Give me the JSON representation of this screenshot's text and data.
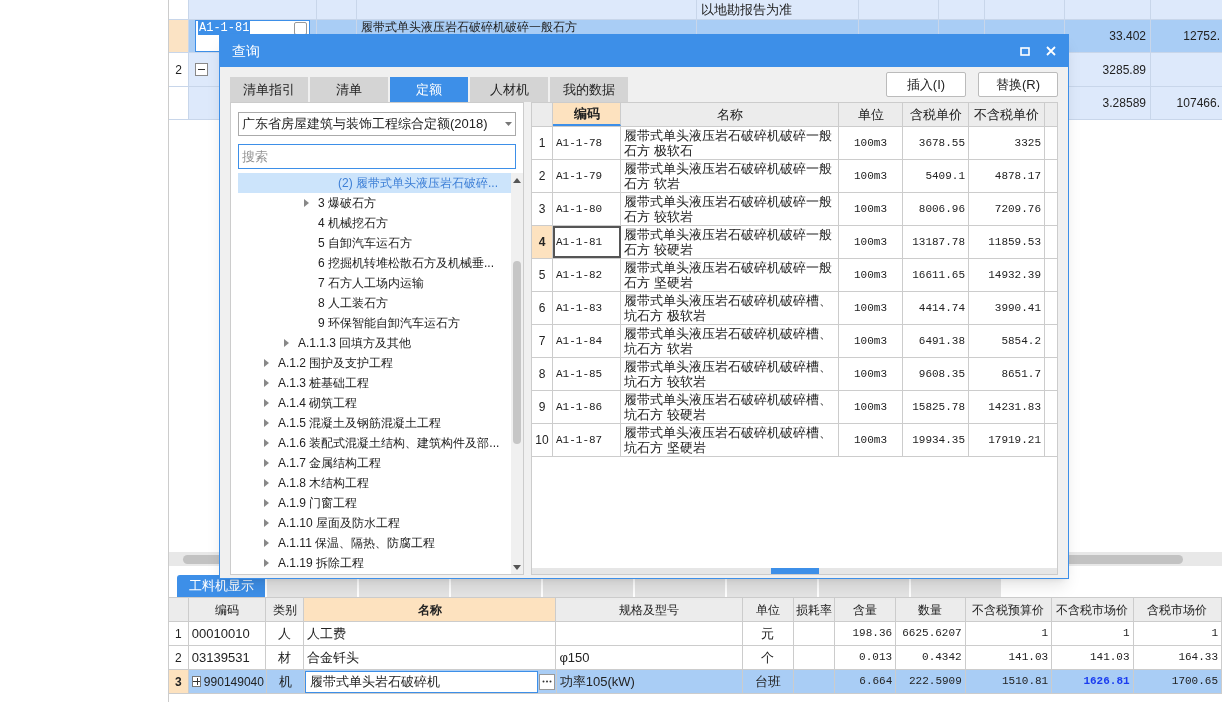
{
  "background_grid": {
    "rows": [
      {
        "kind": "partial",
        "selected": false,
        "note": "以地勘报告为准"
      },
      {
        "kind": "item",
        "code": "A1-1-81",
        "checked": false,
        "selected": true,
        "name": "履带式单头液压岩石破碎机破碎一般石方",
        "values": [
          "33.402",
          "12752."
        ]
      },
      {
        "kind": "group",
        "row_number": "2",
        "expanded": true,
        "selected": false,
        "values": [
          "3285.89"
        ]
      },
      {
        "kind": "plain",
        "selected": false,
        "values": [
          "3.28589",
          "107466."
        ]
      }
    ]
  },
  "dialog": {
    "title": "查询",
    "tabs": [
      {
        "label": "清单指引",
        "selected": false
      },
      {
        "label": "清单",
        "selected": false
      },
      {
        "label": "定额",
        "selected": true
      },
      {
        "label": "人材机",
        "selected": false
      },
      {
        "label": "我的数据",
        "selected": false
      }
    ],
    "buttons": [
      "插入(I)",
      "替换(R)"
    ],
    "library": "广东省房屋建筑与装饰工程综合定额(2018)",
    "search": {
      "placeholder": "搜索"
    },
    "tree": [
      {
        "children": [
          {
            "children": [
              {
                "children": [
                  {
                    "label": "(2) 履带式单头液压岩石破碎...",
                    "selected": true
                  }
                ]
              },
              {
                "label": "3 爆破石方",
                "expanded": false,
                "selected": false
              },
              {
                "label": "4 机械挖石方",
                "selected": false
              },
              {
                "label": "5 自卸汽车运石方",
                "selected": false
              },
              {
                "label": "6 挖掘机转堆松散石方及机械垂...",
                "selected": false
              },
              {
                "label": "7 石方人工场内运输",
                "selected": false
              },
              {
                "label": "8 人工装石方",
                "selected": false
              },
              {
                "label": "9 环保智能自卸汽车运石方",
                "selected": false
              }
            ]
          },
          {
            "label": "A.1.1.3 回填方及其他",
            "expanded": false,
            "selected": false
          }
        ]
      },
      {
        "label": "A.1.2 围护及支护工程",
        "expanded": false,
        "selected": false
      },
      {
        "label": "A.1.3 桩基础工程",
        "expanded": false,
        "selected": false
      },
      {
        "label": "A.1.4 砌筑工程",
        "expanded": false,
        "selected": false
      },
      {
        "label": "A.1.5 混凝土及钢筋混凝土工程",
        "expanded": false,
        "selected": false
      },
      {
        "label": "A.1.6 装配式混凝土结构、建筑构件及部...",
        "expanded": false,
        "selected": false
      },
      {
        "label": "A.1.7 金属结构工程",
        "expanded": false,
        "selected": false
      },
      {
        "label": "A.1.8 木结构工程",
        "expanded": false,
        "selected": false
      },
      {
        "label": "A.1.9 门窗工程",
        "expanded": false,
        "selected": false
      },
      {
        "label": "A.1.10 屋面及防水工程",
        "expanded": false,
        "selected": false
      },
      {
        "label": "A.1.11 保温、隔热、防腐工程",
        "expanded": false,
        "selected": false
      },
      {
        "label": "A.1.19 拆除工程",
        "expanded": false,
        "selected": false
      }
    ],
    "table": {
      "columns": [
        {
          "label": "编码",
          "active": true
        },
        {
          "label": "名称",
          "active": false
        },
        {
          "label": "单位",
          "active": false
        },
        {
          "label": "含税单价",
          "active": false
        },
        {
          "label": "不含税单价",
          "active": false
        }
      ],
      "rows": [
        {
          "number": "1",
          "selected": false,
          "cells": [
            "A1-1-78",
            "履带式单头液压岩石破碎机破碎一般石方 极软石",
            "100m3",
            "3678.55",
            "3325"
          ]
        },
        {
          "number": "2",
          "selected": false,
          "cells": [
            "A1-1-79",
            "履带式单头液压岩石破碎机破碎一般石方 软岩",
            "100m3",
            "5409.1",
            "4878.17"
          ]
        },
        {
          "number": "3",
          "selected": false,
          "cells": [
            "A1-1-80",
            "履带式单头液压岩石破碎机破碎一般石方 较软岩",
            "100m3",
            "8006.96",
            "7209.76"
          ]
        },
        {
          "number": "4",
          "selected": true,
          "cells": [
            "A1-1-81",
            "履带式单头液压岩石破碎机破碎一般石方 较硬岩",
            "100m3",
            "13187.78",
            "11859.53"
          ]
        },
        {
          "number": "5",
          "selected": false,
          "cells": [
            "A1-1-82",
            "履带式单头液压岩石破碎机破碎一般石方 坚硬岩",
            "100m3",
            "16611.65",
            "14932.39"
          ]
        },
        {
          "number": "6",
          "selected": false,
          "cells": [
            "A1-1-83",
            "履带式单头液压岩石破碎机破碎槽、坑石方 极软岩",
            "100m3",
            "4414.74",
            "3990.41"
          ]
        },
        {
          "number": "7",
          "selected": false,
          "cells": [
            "A1-1-84",
            "履带式单头液压岩石破碎机破碎槽、坑石方 软岩",
            "100m3",
            "6491.38",
            "5854.2"
          ]
        },
        {
          "number": "8",
          "selected": false,
          "cells": [
            "A1-1-85",
            "履带式单头液压岩石破碎机破碎槽、坑石方 较软岩",
            "100m3",
            "9608.35",
            "8651.7"
          ]
        },
        {
          "number": "9",
          "selected": false,
          "cells": [
            "A1-1-86",
            "履带式单头液压岩石破碎机破碎槽、坑石方 较硬岩",
            "100m3",
            "15825.78",
            "14231.83"
          ]
        },
        {
          "number": "10",
          "selected": false,
          "cells": [
            "A1-1-87",
            "履带式单头液压岩石破碎机破碎槽、坑石方 坚硬岩",
            "100m3",
            "19934.35",
            "17919.21"
          ]
        }
      ]
    }
  },
  "bottom_tab": {
    "label": "工料机显示",
    "selected": true
  },
  "resource_table": {
    "columns": [
      {
        "label": "编码",
        "active": false
      },
      {
        "label": "类别",
        "active": false
      },
      {
        "label": "名称",
        "active": true
      },
      {
        "label": "规格及型号",
        "active": false
      },
      {
        "label": "单位",
        "active": false
      },
      {
        "label": "损耗率",
        "active": false
      },
      {
        "label": "含量",
        "active": false
      },
      {
        "label": "数量",
        "active": false
      },
      {
        "label": "不含税预算价",
        "active": false
      },
      {
        "label": "不含税市场价",
        "active": false
      },
      {
        "label": "含税市场价",
        "active": false
      }
    ],
    "rows": [
      {
        "number": "1",
        "selected": false,
        "price_changed": false,
        "cells": [
          "00010010",
          "人",
          "人工费",
          "",
          "元",
          "",
          "198.36",
          "6625.6207",
          "1",
          "1",
          "1"
        ]
      },
      {
        "number": "2",
        "selected": false,
        "price_changed": false,
        "cells": [
          "03139531",
          "材",
          "合金钎头",
          "φ150",
          "个",
          "",
          "0.013",
          "0.4342",
          "141.03",
          "141.03",
          "164.33"
        ]
      },
      {
        "number": "3",
        "selected": true,
        "expanded": false,
        "price_changed": true,
        "cells": [
          "990149040",
          "机",
          "履带式单头岩石破碎机",
          "功率105(kW)",
          "台班",
          "",
          "6.664",
          "222.5909",
          "1510.81",
          "1626.81",
          "1700.65"
        ]
      }
    ]
  }
}
